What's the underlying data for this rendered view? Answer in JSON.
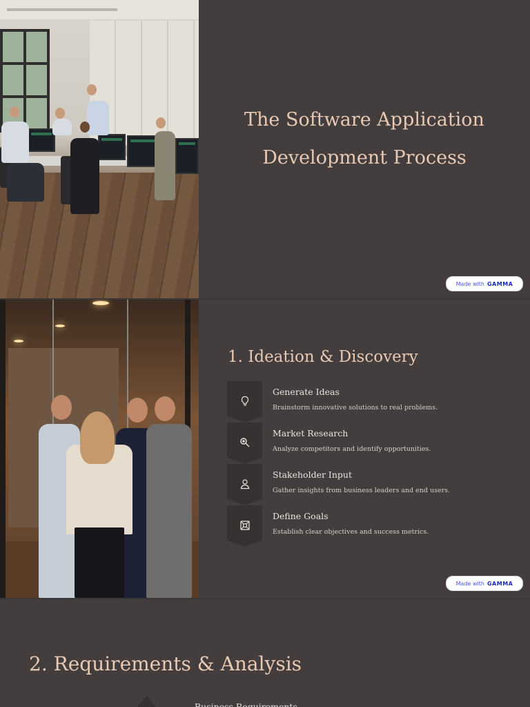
{
  "slides": [
    {
      "title_line1": "The Software Application",
      "title_line2": "Development Process",
      "badge": {
        "made_with": "Made with",
        "brand": "GAMMA"
      }
    },
    {
      "heading": "1. Ideation & Discovery",
      "items": [
        {
          "icon": "lightbulb-icon",
          "title": "Generate Ideas",
          "desc": "Brainstorm innovative solutions to real problems."
        },
        {
          "icon": "magnifier-icon",
          "title": "Market Research",
          "desc": "Analyze competitors and identify opportunities."
        },
        {
          "icon": "person-icon",
          "title": "Stakeholder Input",
          "desc": "Gather insights from business leaders and end users."
        },
        {
          "icon": "target-icon",
          "title": "Define Goals",
          "desc": "Establish clear objectives and success metrics."
        }
      ],
      "badge": {
        "made_with": "Made with",
        "brand": "GAMMA"
      }
    },
    {
      "heading": "2. Requirements & Analysis",
      "peek_text": "Business Requirements"
    }
  ],
  "colors": {
    "background": "#433e3d",
    "heading": "#e8c9b4",
    "chevron": "#363231",
    "badge_brand": "#1c2bb5"
  }
}
